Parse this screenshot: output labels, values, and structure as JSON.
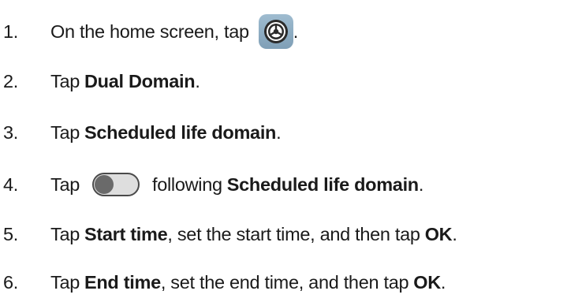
{
  "steps": [
    {
      "number": "1.",
      "before": "On the home screen, tap",
      "icon": "settings-gear-icon",
      "after": "."
    },
    {
      "number": "2.",
      "before": "Tap",
      "bold": "Dual Domain",
      "after": "."
    },
    {
      "number": "3.",
      "before": "Tap",
      "bold": "Scheduled life domain",
      "after": "."
    },
    {
      "number": "4.",
      "before": "Tap",
      "icon": "toggle-switch-off-icon",
      "middle": "following",
      "bold": "Scheduled life domain",
      "after": "."
    },
    {
      "number": "5.",
      "before": "Tap",
      "bold": "Start time",
      "middle": ", set the start time, and then tap",
      "bold2": "OK",
      "after": "."
    },
    {
      "number": "6.",
      "before": "Tap",
      "bold": "End time",
      "middle": ", set the end time, and then tap",
      "bold2": "OK",
      "after": "."
    }
  ],
  "colors": {
    "text": "#1a1a1a",
    "settings_icon_bg": "#8fadc3",
    "toggle_track": "#dedede",
    "toggle_knob": "#6a6a6a"
  }
}
